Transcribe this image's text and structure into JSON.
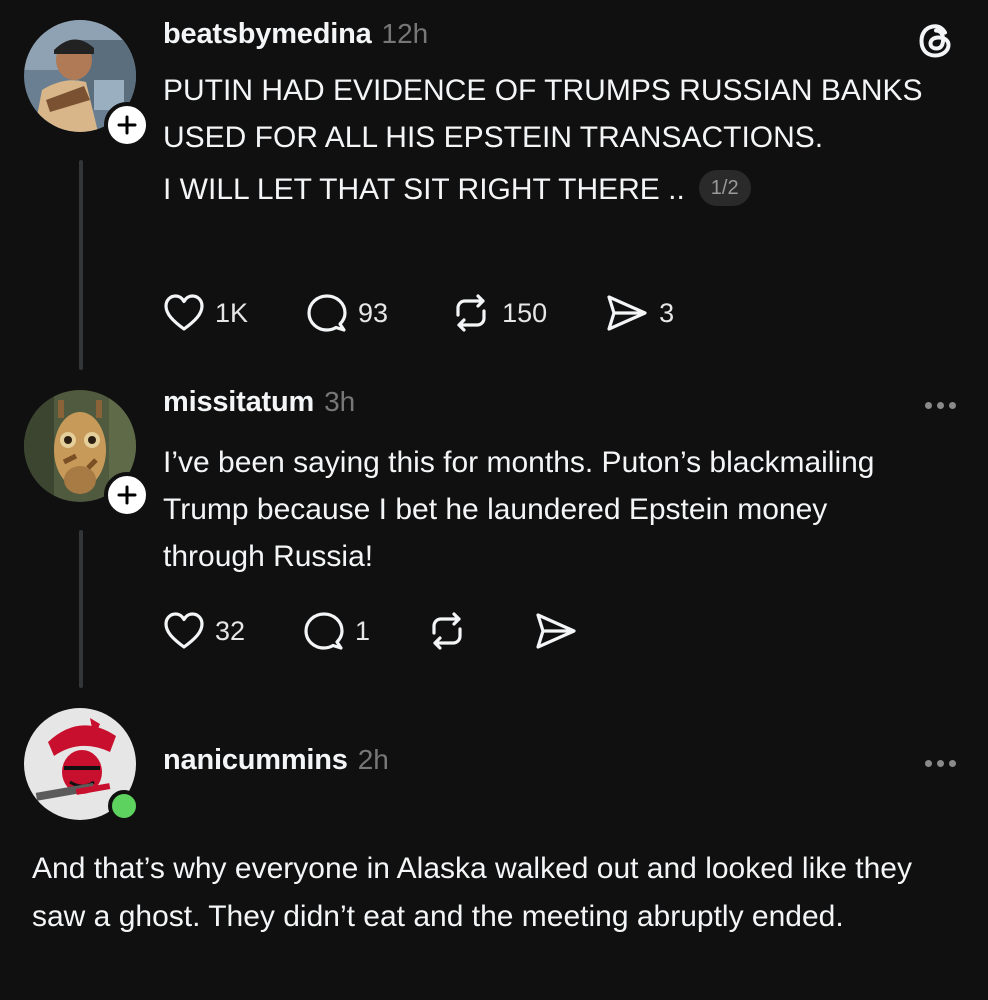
{
  "posts": [
    {
      "username": "beatsbymedina",
      "time": "12h",
      "paragraphs": [
        "PUTIN HAD EVIDENCE OF TRUMPS RUSSIAN BANKS USED FOR ALL HIS EPSTEIN TRANSACTIONS.",
        "I WILL LET THAT SIT RIGHT THERE .."
      ],
      "page_indicator": "1/2",
      "likes": "1K",
      "replies": "93",
      "reposts": "150",
      "shares": "3"
    },
    {
      "username": "missitatum",
      "time": "3h",
      "text": "I’ve been saying this for months. Puton’s blackmailing Trump because I bet he laundered Epstein money through Russia!",
      "likes": "32",
      "replies": "1"
    },
    {
      "username": "nanicummins",
      "time": "2h",
      "text": "And that’s why everyone in Alaska walked out and looked like they saw a ghost. They didn’t eat and the meeting abruptly ended."
    }
  ],
  "icons": {
    "app": "threads-logo-icon",
    "like": "heart-icon",
    "reply": "comment-bubble-icon",
    "repost": "repost-icon",
    "share": "send-icon",
    "more": "more-options-icon",
    "follow": "plus-icon"
  },
  "colors": {
    "background": "#101010",
    "text": "#f3f5f7",
    "muted": "#777777",
    "online": "#5ed25e"
  }
}
